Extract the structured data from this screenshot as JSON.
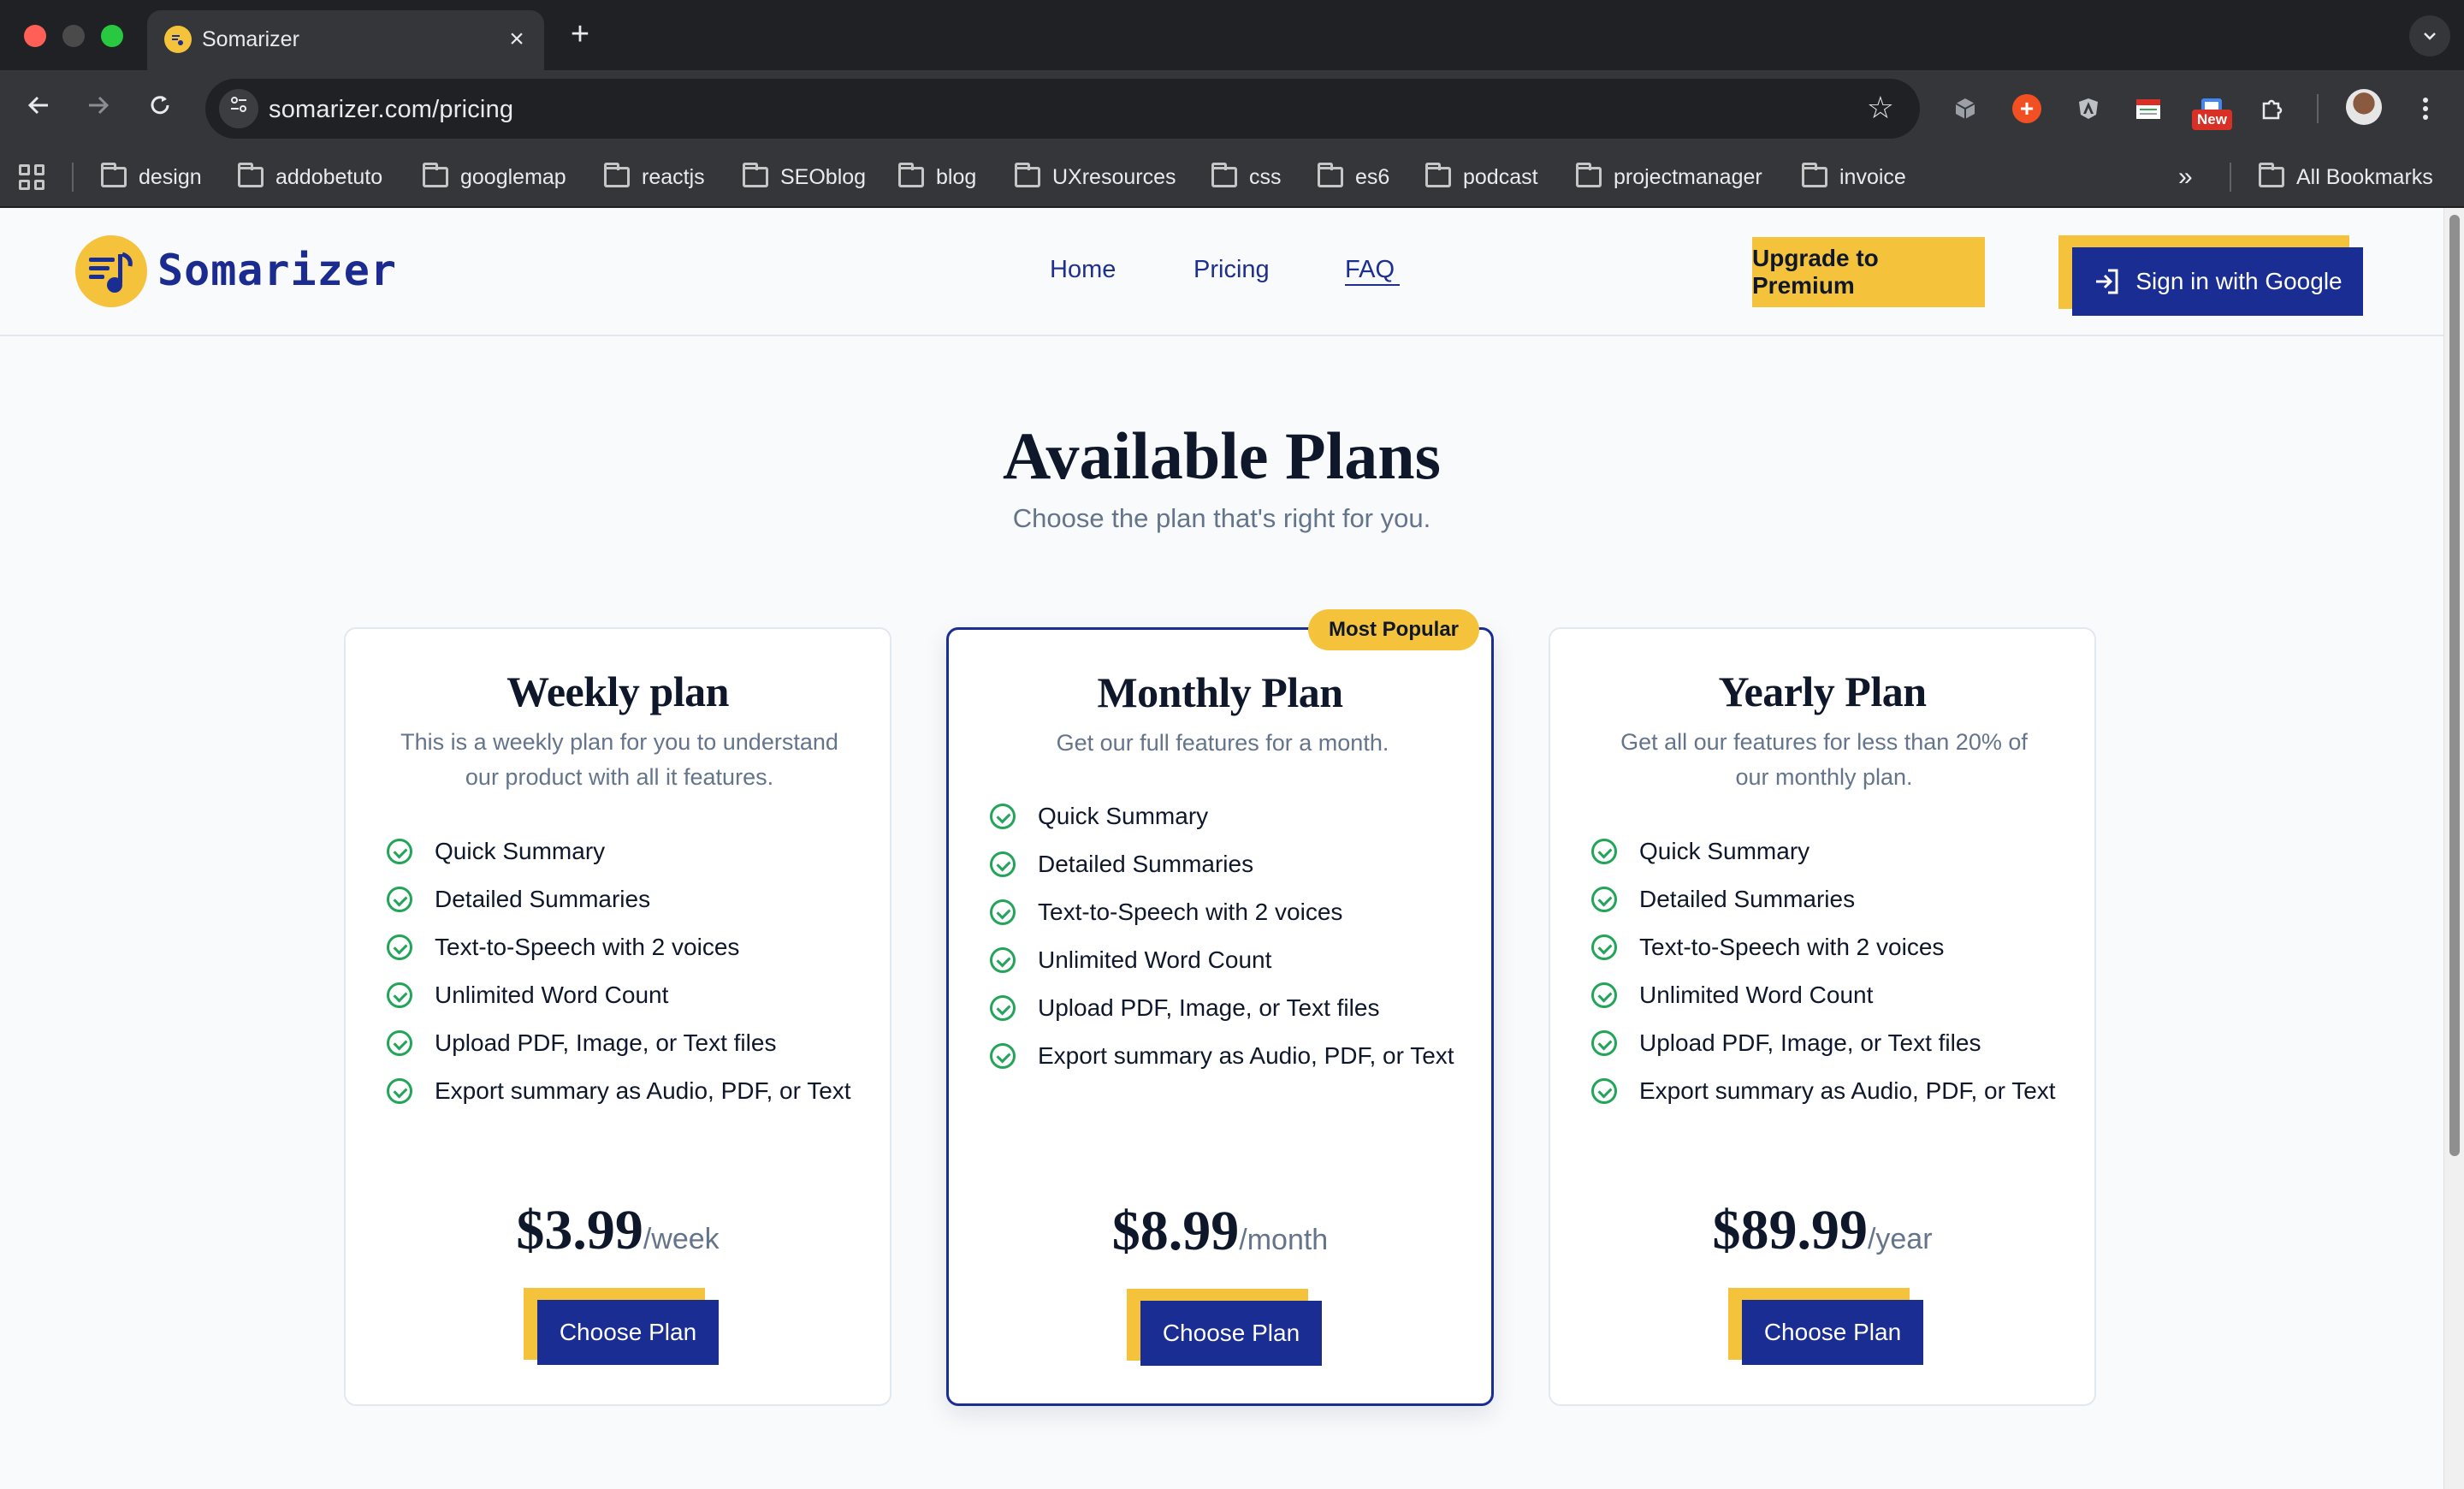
{
  "browser": {
    "tab_title": "Somarizer",
    "tab_close": "×",
    "new_tab": "+",
    "url": "somarizer.com/pricing",
    "new_badge": "New",
    "bookmarks": [
      "design",
      "addobetuto",
      "googlemap",
      "reactjs",
      "SEOblog",
      "blog",
      "UXresources",
      "css",
      "es6",
      "podcast",
      "projectmanager",
      "invoice"
    ],
    "overflow": "»",
    "all_bookmarks": "All Bookmarks"
  },
  "header": {
    "brand": "Somarizer",
    "nav": [
      "Home",
      "Pricing",
      "FAQ"
    ],
    "upgrade_label": "Upgrade to Premium",
    "signin_label": "Sign in with Google"
  },
  "hero": {
    "title": "Available Plans",
    "subtitle": "Choose the plan that's right for you."
  },
  "plans": [
    {
      "name": "Weekly plan",
      "description": "This is a weekly plan for you to understand our product with all it features.",
      "features": [
        "Quick Summary",
        "Detailed Summaries",
        "Text-to-Speech with 2 voices",
        "Unlimited Word Count",
        "Upload PDF, Image, or Text files",
        "Export summary as Audio, PDF, or Text"
      ],
      "price": "$3.99",
      "period": "/week",
      "cta": "Choose Plan"
    },
    {
      "name": "Monthly Plan",
      "badge": "Most Popular",
      "description": "Get our full features for a month.",
      "features": [
        "Quick Summary",
        "Detailed Summaries",
        "Text-to-Speech with 2 voices",
        "Unlimited Word Count",
        "Upload PDF, Image, or Text files",
        "Export summary as Audio, PDF, or Text"
      ],
      "price": "$8.99",
      "period": "/month",
      "cta": "Choose Plan"
    },
    {
      "name": "Yearly Plan",
      "description": "Get all our features for less than 20% of our monthly plan.",
      "features": [
        "Quick Summary",
        "Detailed Summaries",
        "Text-to-Speech with 2 voices",
        "Unlimited Word Count",
        "Upload PDF, Image, or Text files",
        "Export summary as Audio, PDF, or Text"
      ],
      "price": "$89.99",
      "period": "/year",
      "cta": "Choose Plan"
    }
  ],
  "colors": {
    "brand_blue": "#1a2d93",
    "accent_yellow": "#f5c33b",
    "check_green": "#22a559"
  }
}
